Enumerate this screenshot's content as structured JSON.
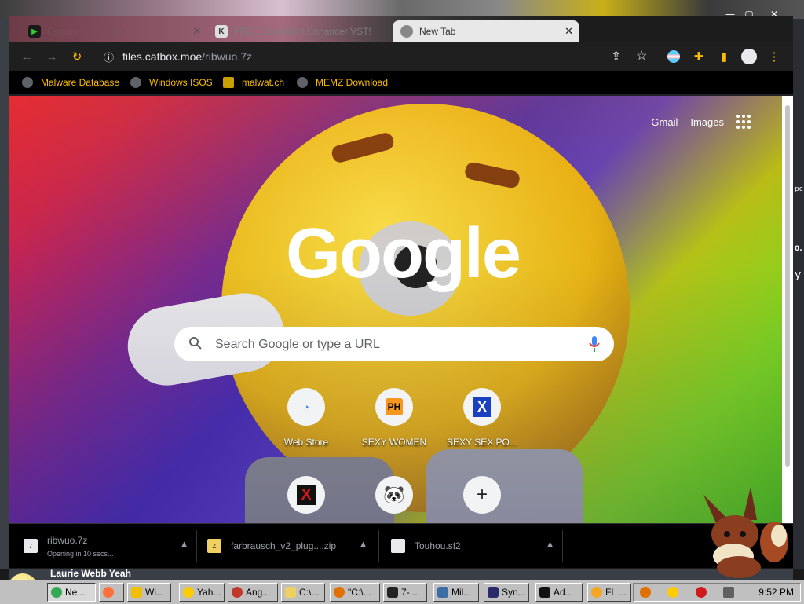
{
  "window": {
    "tabs": [
      {
        "label": "Cygwin Installation",
        "icon": "terminal-icon"
      },
      {
        "label": "FREE Soundfont Enhancer VST!",
        "icon": "k-logo-icon"
      },
      {
        "label": "New Tab",
        "icon": "chrome-icon",
        "active": true
      }
    ],
    "close_tab": "✕",
    "controls": {
      "minimize": "—",
      "maximize": "▢",
      "close": "✕"
    }
  },
  "toolbar": {
    "url_host": "files.catbox.moe",
    "url_path": "/ribwuo.7z"
  },
  "bookmarks": [
    {
      "label": "Malware Database",
      "icon": "globe-icon"
    },
    {
      "label": "Windows ISOS",
      "icon": "globe-icon"
    },
    {
      "label": "malwat.ch",
      "icon": "malwatch-icon"
    },
    {
      "label": "MEMZ Download",
      "icon": "globe-icon"
    }
  ],
  "newtab": {
    "links": {
      "gmail": "Gmail",
      "images": "Images"
    },
    "logo": "Google",
    "search_placeholder": "Search Google or type a URL",
    "shortcuts": [
      {
        "label": "Web Store",
        "glyph": "◔",
        "color": "#4285f4"
      },
      {
        "label": "SEXY WOMEN",
        "glyph": "PH",
        "color": "#f7971d"
      },
      {
        "label": "SEXY SEX PO...",
        "glyph": "X",
        "color": "#1a3fc0"
      },
      {
        "label": "",
        "glyph": "X",
        "color": "#d01919"
      },
      {
        "label": "",
        "glyph": "🐼",
        "color": "#333333"
      },
      {
        "label": "",
        "glyph": "+",
        "color": "#202124"
      }
    ]
  },
  "downloads": [
    {
      "name": "ribwuo.7z",
      "status": "Opening in 10 secs..."
    },
    {
      "name": "farbrausch_v2_plug....zip",
      "status": ""
    },
    {
      "name": "Touhou.sf2",
      "status": ""
    }
  ],
  "desktop": {
    "bottom_text": "Laurie Webb Yeah",
    "right_fragments": [
      "pc",
      "0.",
      "y"
    ]
  },
  "taskbar": {
    "buttons": [
      {
        "label": "Ne...",
        "color": "#34a853",
        "active": true
      },
      {
        "label": "",
        "color": "#ff7139"
      },
      {
        "label": "Wi...",
        "color": "#f0c000"
      },
      {
        "label": "Yah...",
        "color": "#ffcc00"
      },
      {
        "label": "Ang...",
        "color": "#c0392b"
      },
      {
        "label": "C:\\...",
        "color": "#f0d060"
      },
      {
        "label": "\"C:\\...",
        "color": "#e07000"
      },
      {
        "label": "7-...",
        "color": "#222222"
      },
      {
        "label": "Mil...",
        "color": "#3a6ea5"
      },
      {
        "label": "Syn...",
        "color": "#2a2a6a"
      },
      {
        "label": "Ad...",
        "color": "#111111"
      },
      {
        "label": "FL ...",
        "color": "#f5a623"
      }
    ],
    "clock": "9:52 PM"
  }
}
